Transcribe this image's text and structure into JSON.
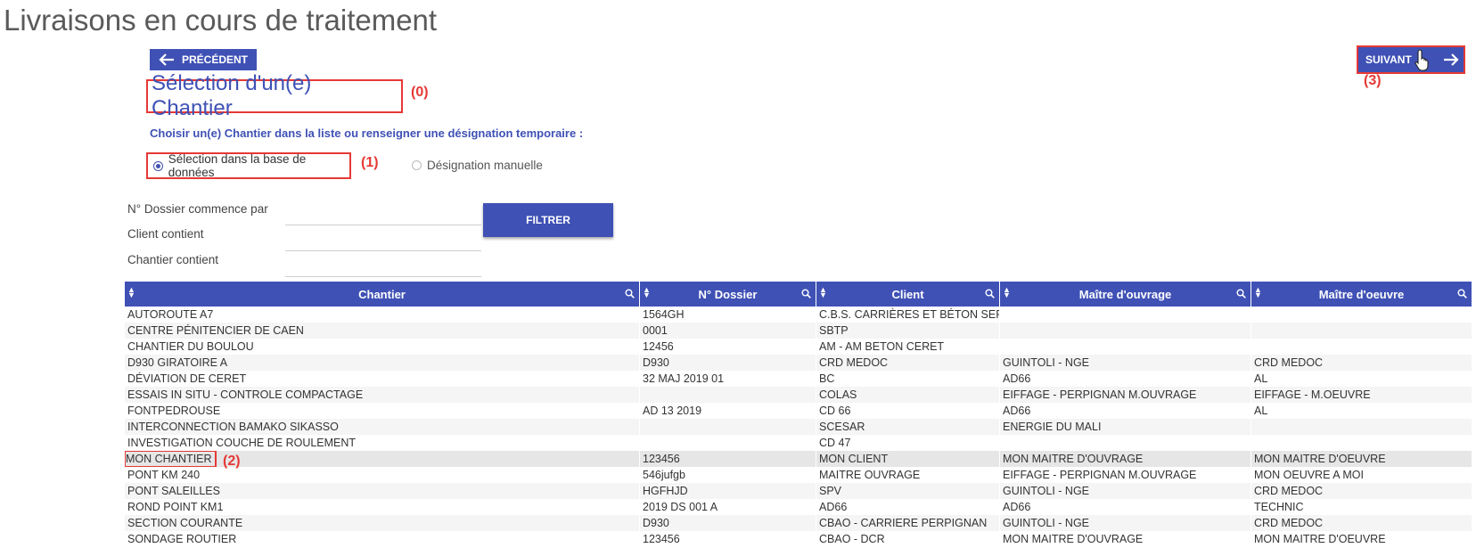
{
  "page": {
    "title": "Livraisons en cours de traitement"
  },
  "nav": {
    "prev_label": "PRÉCÉDENT",
    "next_label": "SUIVANT"
  },
  "section": {
    "title": "Sélection d'un(e) Chantier",
    "instruction": "Choisir un(e) Chantier dans la liste ou renseigner une désignation temporaire :"
  },
  "radio": {
    "db_label": "Sélection dans la base de données",
    "db_selected": true,
    "manual_label": "Désignation manuelle"
  },
  "filters": {
    "dossier_label": "N° Dossier commence par",
    "client_label": "Client contient",
    "chantier_label": "Chantier contient",
    "dossier_value": "",
    "client_value": "",
    "chantier_value": "",
    "button_label": "FILTRER"
  },
  "annotations": {
    "a0": "(0)",
    "a1": "(1)",
    "a2": "(2)",
    "a3": "(3)"
  },
  "grid": {
    "columns": [
      "Chantier",
      "N° Dossier",
      "Client",
      "Maître d'ouvrage",
      "Maître d'oeuvre"
    ],
    "rows": [
      [
        "AUTOROUTE A7",
        "1564GH",
        "C.B.S. CARRIÈRES ET BÉTON SERV",
        "",
        ""
      ],
      [
        "CENTRE PÉNITENCIER DE CAEN",
        "0001",
        "SBTP",
        "",
        ""
      ],
      [
        "CHANTIER DU BOULOU",
        "12456",
        "AM - AM BETON CERET",
        "",
        ""
      ],
      [
        "D930 GIRATOIRE A",
        "D930",
        "CRD MEDOC",
        "GUINTOLI - NGE",
        "CRD MEDOC"
      ],
      [
        "DÉVIATION DE CERET",
        "32 MAJ 2019 01",
        "BC",
        "AD66",
        "AL"
      ],
      [
        "ESSAIS IN SITU - CONTROLE COMPACTAGE",
        "",
        "COLAS",
        "EIFFAGE - PERPIGNAN M.OUVRAGE",
        "EIFFAGE - M.OEUVRE"
      ],
      [
        "FONTPEDROUSE",
        "AD 13 2019",
        "CD 66",
        "AD66",
        "AL"
      ],
      [
        "INTERCONNECTION BAMAKO SIKASSO",
        "",
        "SCESAR",
        "ENERGIE DU MALI",
        ""
      ],
      [
        "INVESTIGATION COUCHE DE ROULEMENT",
        "",
        "CD 47",
        "",
        ""
      ],
      [
        "MON CHANTIER",
        "123456",
        "MON CLIENT",
        "MON MAITRE D'OUVRAGE",
        "MON MAITRE D'OEUVRE"
      ],
      [
        "PONT KM 240",
        "546jufgb",
        "MAITRE OUVRAGE",
        "EIFFAGE - PERPIGNAN M.OUVRAGE",
        "MON OEUVRE A MOI"
      ],
      [
        "PONT SALEILLES",
        "HGFHJD",
        "SPV",
        "GUINTOLI - NGE",
        "CRD MEDOC"
      ],
      [
        "ROND POINT KM1",
        "2019 DS 001 A",
        "AD66",
        "AD66",
        "TECHNIC"
      ],
      [
        "SECTION COURANTE",
        "D930",
        "CBAO - CARRIERE PERPIGNAN",
        "GUINTOLI - NGE",
        "CRD MEDOC"
      ],
      [
        "SONDAGE ROUTIER",
        "123456",
        "CBAO - DCR",
        "MON MAITRE D'OUVRAGE",
        "MON MAITRE D'OEUVRE"
      ]
    ],
    "selected_row": 9
  },
  "icons": {
    "prev": "arrow-left-icon",
    "next": "arrow-right-icon",
    "cursor": "hand-pointer-icon",
    "sort": "sort-icon",
    "search": "search-icon"
  },
  "colors": {
    "primary": "#3f51b5",
    "annotation": "#e53935"
  }
}
